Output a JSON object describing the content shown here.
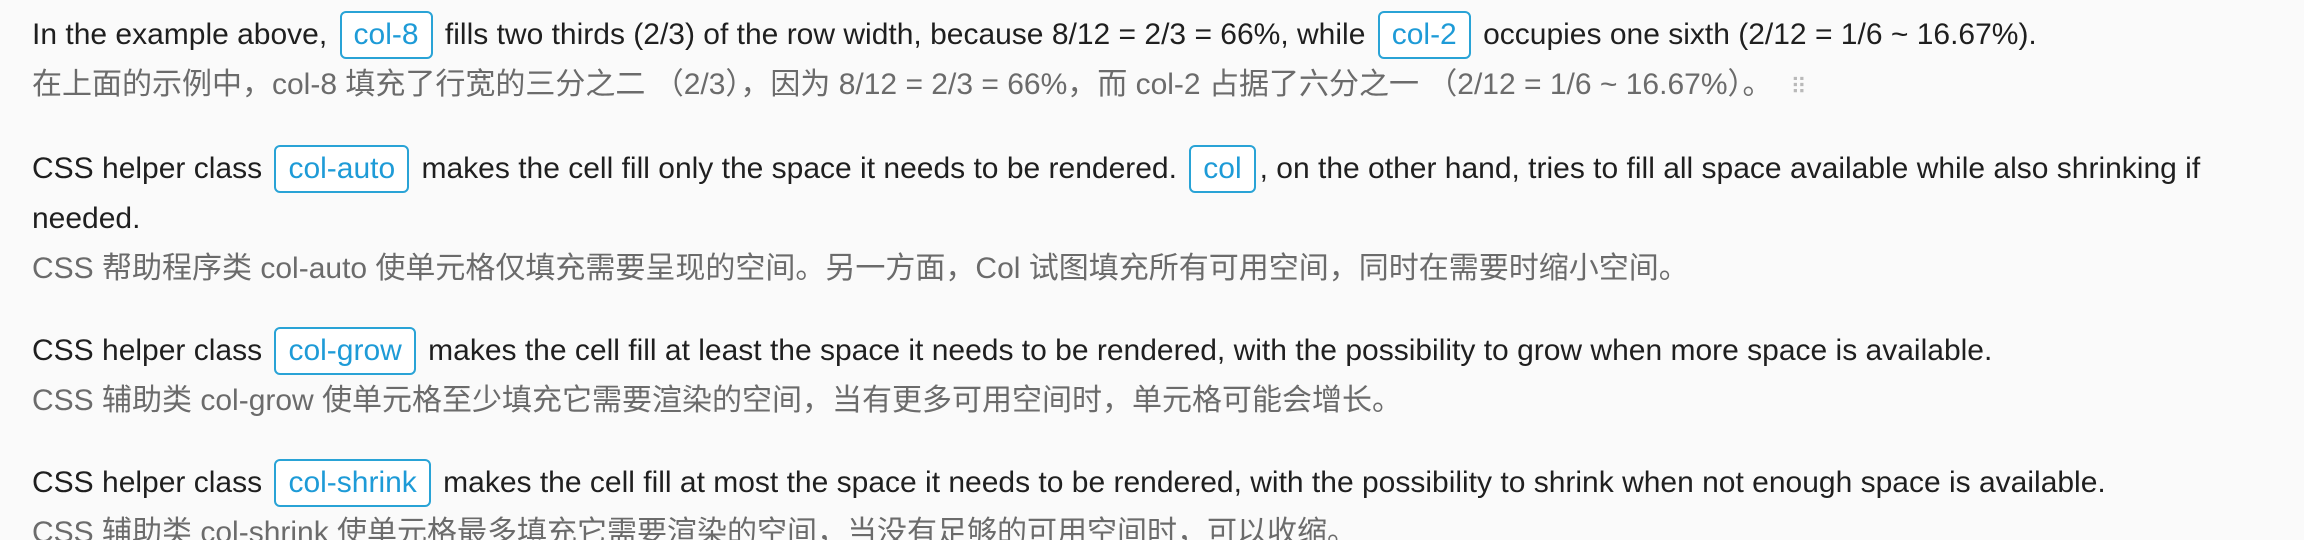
{
  "p1": {
    "en_a": "In the example above, ",
    "code_a": "col-8",
    "en_b": " fills two thirds (2/3) of the row width, because 8/12 = 2/3 = 66%, while ",
    "code_b": "col-2",
    "en_c": " occupies one sixth (2/12 = 1/6 ~ 16.67%).",
    "zh": "在上面的示例中，col-8 填充了行宽的三分之二 （2/3），因为 8/12 = 2/3 = 66%，而 col-2 占据了六分之一 （2/12 = 1/6 ~ 16.67%）。",
    "handle_icon": "⠿"
  },
  "p2": {
    "en_a": "CSS helper class ",
    "code_a": "col-auto",
    "en_b": " makes the cell fill only the space it needs to be rendered. ",
    "code_b": "col",
    "en_c": ", on the other hand, tries to fill all space available while also shrinking if needed.",
    "zh": "CSS 帮助程序类 col-auto 使单元格仅填充需要呈现的空间。另一方面，Col 试图填充所有可用空间，同时在需要时缩小空间。"
  },
  "p3": {
    "en_a": "CSS helper class ",
    "code_a": "col-grow",
    "en_b": " makes the cell fill at least the space it needs to be rendered, with the possibility to grow when more space is available.",
    "zh": "CSS 辅助类 col-grow 使单元格至少填充它需要渲染的空间，当有更多可用空间时，单元格可能会增长。"
  },
  "p4": {
    "en_a": "CSS helper class ",
    "code_a": "col-shrink",
    "en_b": " makes the cell fill at most the space it needs to be rendered, with the possibility to shrink when not enough space is available.",
    "zh": "CSS 辅助类 col-shrink 使单元格最多填充它需要渲染的空间，当没有足够的可用空间时，可以收缩。"
  }
}
